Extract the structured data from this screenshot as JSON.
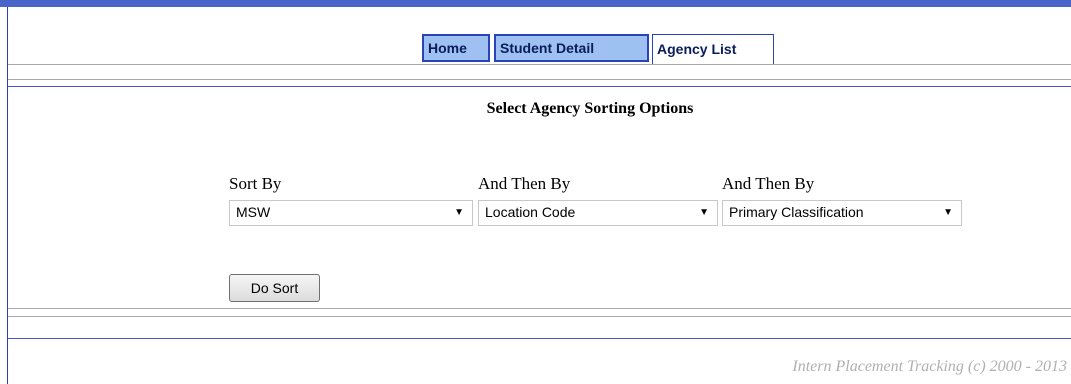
{
  "tabs": [
    {
      "label": "Home",
      "active": false
    },
    {
      "label": "Student Detail",
      "active": false
    },
    {
      "label": "Agency List",
      "active": true
    }
  ],
  "heading": "Select Agency Sorting Options",
  "sort": {
    "sort_by_label": "Sort By",
    "then_by_label_1": "And Then By",
    "then_by_label_2": "And Then By",
    "sort_by_value": "MSW",
    "then_by_value_1": "Location Code",
    "then_by_value_2": "Primary Classification"
  },
  "button": {
    "label": "Do Sort"
  },
  "footer": "Intern Placement Tracking (c) 2000 - 2013",
  "colors": {
    "accent": "#4a66c9",
    "tab_fill": "#9ec1f2",
    "border": "#2a44b8"
  },
  "icons": {
    "dropdown": "chevron-down-icon"
  }
}
